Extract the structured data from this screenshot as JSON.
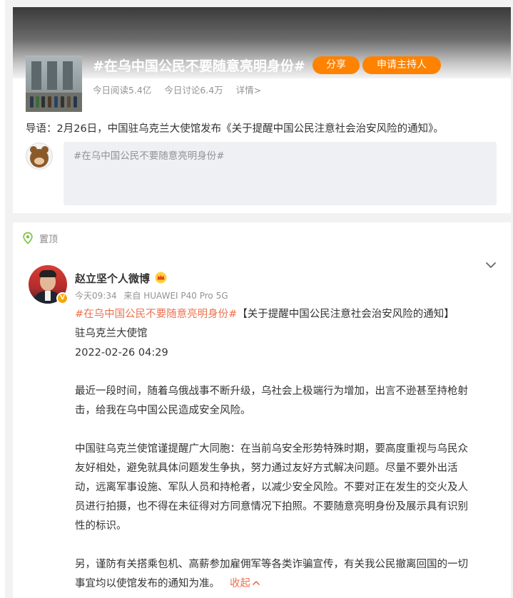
{
  "topic": {
    "title": "#在乌中国公民不要随意亮明身份#",
    "share_label": "分享",
    "host_label": "申请主持人",
    "reads": "今日阅读5.4亿",
    "discussions": "今日讨论6.4万",
    "details": "详情>",
    "intro": "导语：2月26日，中国驻乌克兰大使馆发布《关于提醒中国公民注意社会治安风险的通知》。",
    "compose_placeholder": "#在乌中国公民不要随意亮明身份#"
  },
  "post": {
    "pinned_label": "置顶",
    "author": "赵立坚个人微博",
    "verified_badge": "V",
    "time": "今天09:34",
    "source": "来自 HUAWEI P40 Pro 5G",
    "hashtag": "#在乌中国公民不要随意亮明身份#",
    "headline": "【关于提醒中国公民注意社会治安风险的通知】",
    "issuer": "驻乌克兰大使馆",
    "date": "2022-02-26 04:29",
    "paragraph1": [
      "最近一段时间，随着乌俄战事不断升级，乌社会上极端行为增加，出言不逊甚至持枪射",
      "击，给我在乌中国公民造成安全风险。"
    ],
    "paragraph2": [
      "中国驻乌克兰使馆谨提醒广大同胞：在当前乌安全形势特殊时期，要高度重视与乌民众",
      "友好相处，避免就具体问题发生争执，努力通过友好方式解决问题。尽量不要外出活",
      "动，远离军事设施、军队人员和持枪者，以减少安全风险。不要对正在发生的交火及人",
      "员进行拍摄，也不得在未征得对方同意情况下拍照。不要随意亮明身份及展示具有识别",
      "性的标识。"
    ],
    "paragraph3": [
      "另，谨防有关搭乘包机、高薪参加雇佣军等各类诈骗宣传，有关我公民撤离回国的一切",
      "事宜均以使馆发布的通知为准。"
    ],
    "collapse_label": "收起"
  },
  "colors": {
    "accent": "#ff8200",
    "link": "#eb7350",
    "muted": "#939393"
  }
}
